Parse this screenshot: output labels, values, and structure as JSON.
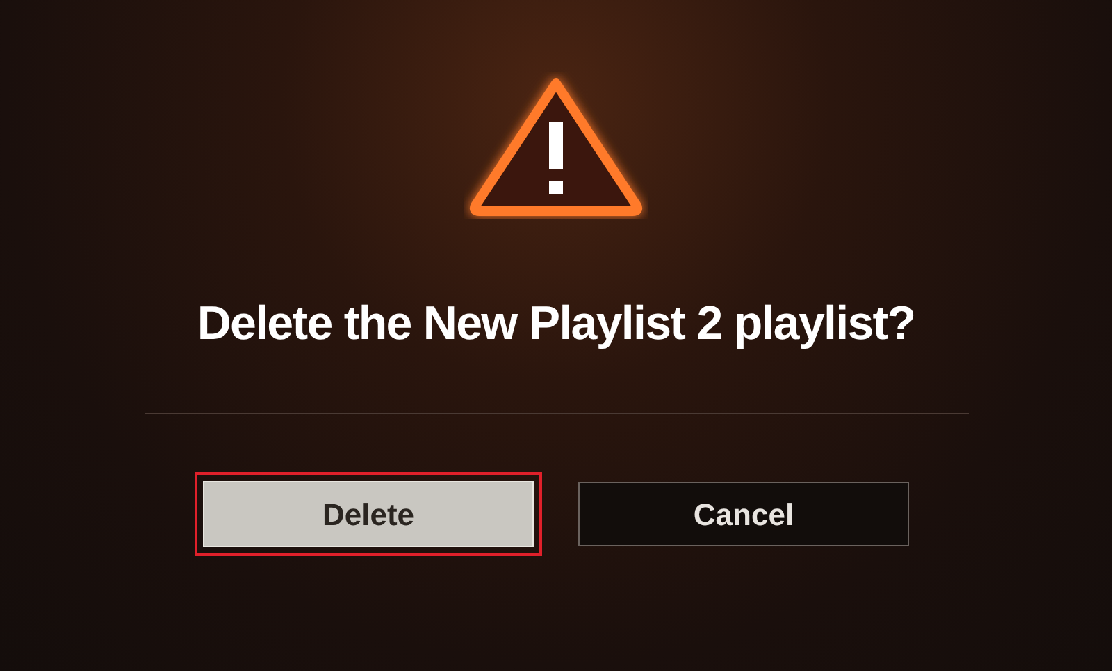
{
  "dialog": {
    "title": "Delete the New Playlist 2 playlist?",
    "buttons": [
      {
        "label": "Delete",
        "selected": true
      },
      {
        "label": "Cancel",
        "selected": false
      }
    ]
  }
}
